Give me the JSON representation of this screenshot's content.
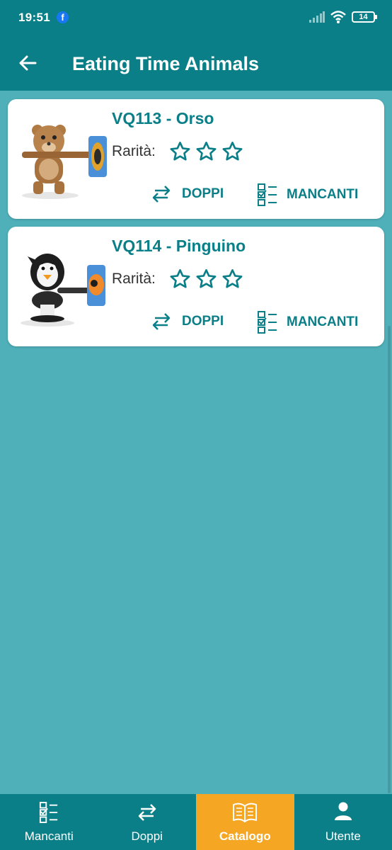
{
  "status": {
    "time": "19:51",
    "battery": "14",
    "fb_glyph": "f"
  },
  "appbar": {
    "title": "Eating Time Animals"
  },
  "cards": [
    {
      "title": "VQ113 - Orso",
      "rarity_label": "Rarità:",
      "stars": 3,
      "doppi_label": "DOPPI",
      "mancanti_label": "MANCANTI"
    },
    {
      "title": "VQ114 - Pinguino",
      "rarity_label": "Rarità:",
      "stars": 3,
      "doppi_label": "DOPPI",
      "mancanti_label": "MANCANTI"
    }
  ],
  "nav": [
    {
      "label": "Mancanti",
      "icon": "checklist-icon"
    },
    {
      "label": "Doppi",
      "icon": "swap-icon"
    },
    {
      "label": "Catalogo",
      "icon": "book-icon",
      "active": true
    },
    {
      "label": "Utente",
      "icon": "user-icon"
    }
  ],
  "colors": {
    "primary": "#0b7f88",
    "background": "#4fb0ba",
    "accent": "#f5a623"
  }
}
